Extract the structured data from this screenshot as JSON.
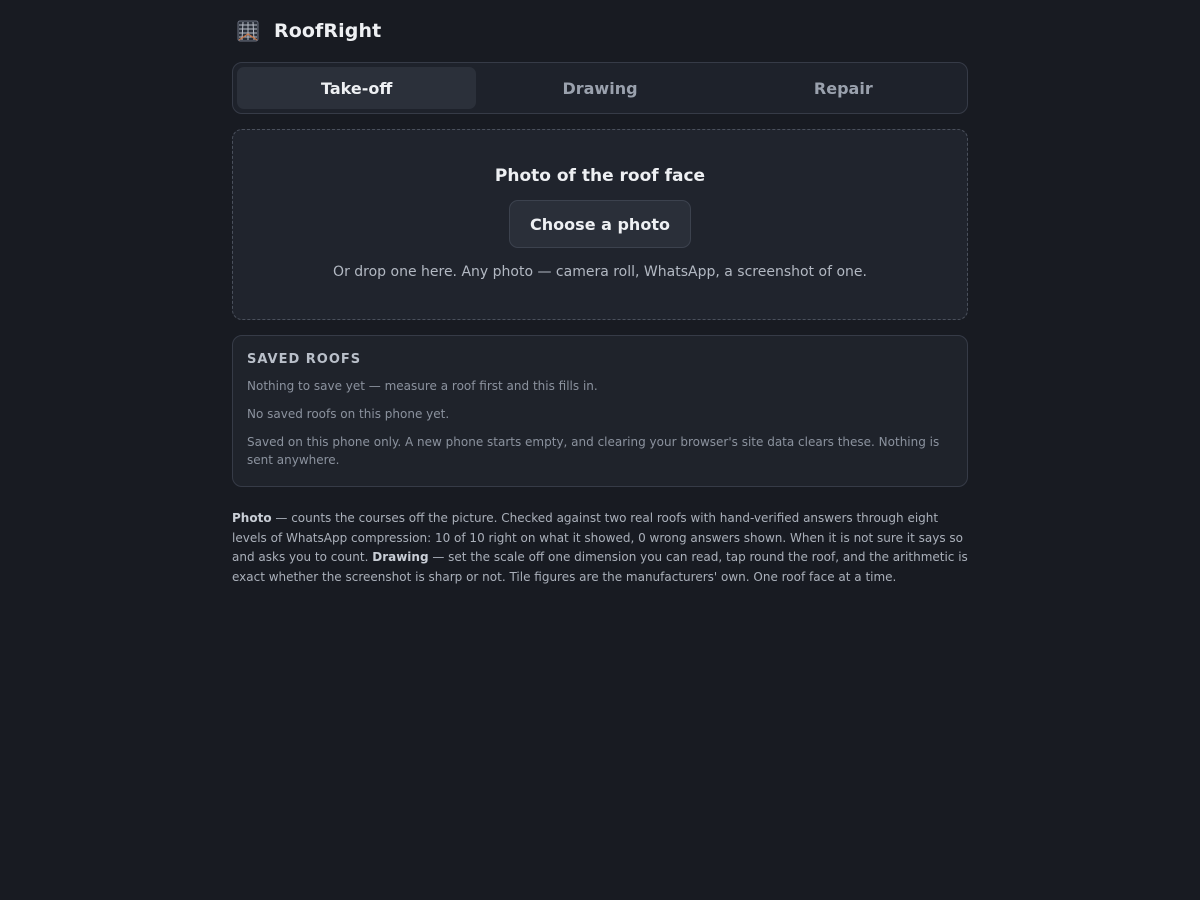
{
  "app": {
    "title": "RoofRight",
    "logo_icon": "roof-tiles-icon"
  },
  "tabs": [
    {
      "label": "Take-off",
      "active": true
    },
    {
      "label": "Drawing",
      "active": false
    },
    {
      "label": "Repair",
      "active": false
    }
  ],
  "upload": {
    "title": "Photo of the roof face",
    "button_label": "Choose a photo",
    "hint": "Or drop one here. Any photo — camera roll, WhatsApp, a screenshot of one."
  },
  "saved_roofs": {
    "title": "SAVED ROOFS",
    "line1": "Nothing to save yet — measure a roof first and this fills in.",
    "line2": "No saved roofs on this phone yet.",
    "line3": "Saved on this phone only. A new phone starts empty, and clearing your browser's site data clears these. Nothing is sent anywhere."
  },
  "footnote": {
    "photo_label": "Photo",
    "photo_text": " — counts the courses off the picture. Checked against two real roofs with hand-verified answers through eight levels of WhatsApp compression: 10 of 10 right on what it showed, 0 wrong answers shown. When it is not sure it says so and asks you to count. ",
    "drawing_label": "Drawing",
    "drawing_text": " — set the scale off one dimension you can read, tap round the roof, and the arithmetic is exact whether the screenshot is sharp or not. Tile figures are the manufacturers' own. One roof face at a time."
  },
  "colors": {
    "background": "#181b22",
    "panel": "#20242d",
    "border": "#363b47",
    "active_tab": "#2b303a",
    "logo_accent": "#c8784a"
  }
}
